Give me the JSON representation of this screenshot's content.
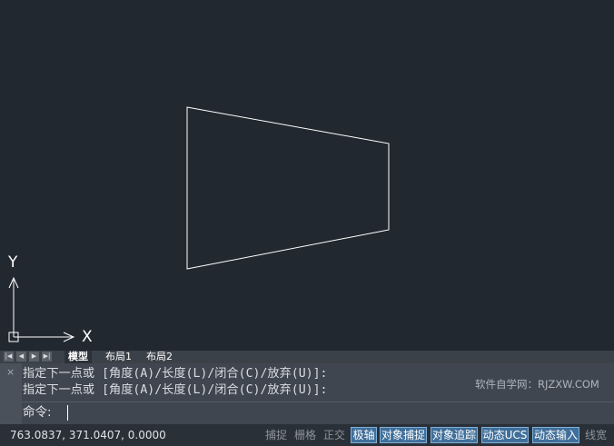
{
  "canvas": {
    "axis_x_label": "X",
    "axis_y_label": "Y",
    "line_color": "#ffffff",
    "background": "#212830"
  },
  "tabs": {
    "nav": [
      "|◀",
      "◀",
      "▶",
      "▶|"
    ],
    "items": [
      {
        "label": "模型",
        "active": true
      },
      {
        "label": "布局1",
        "active": false
      },
      {
        "label": "布局2",
        "active": false
      }
    ]
  },
  "command": {
    "close_icon": "×",
    "history": [
      "指定下一点或 [角度(A)/长度(L)/闭合(C)/放弃(U)]:",
      "指定下一点或 [角度(A)/长度(L)/闭合(C)/放弃(U)]:"
    ],
    "prompt": "命令:",
    "input_value": ""
  },
  "watermark": "软件自学网：RJZXW.COM",
  "status": {
    "coordinates": "763.0837, 371.0407, 0.0000",
    "buttons": [
      {
        "label": "捕捉",
        "on": false
      },
      {
        "label": "栅格",
        "on": false
      },
      {
        "label": "正交",
        "on": false
      },
      {
        "label": "极轴",
        "on": true
      },
      {
        "label": "对象捕捉",
        "on": true
      },
      {
        "label": "对象追踪",
        "on": true
      },
      {
        "label": "动态UCS",
        "on": true
      },
      {
        "label": "动态输入",
        "on": true
      },
      {
        "label": "线宽",
        "on": false
      }
    ]
  }
}
